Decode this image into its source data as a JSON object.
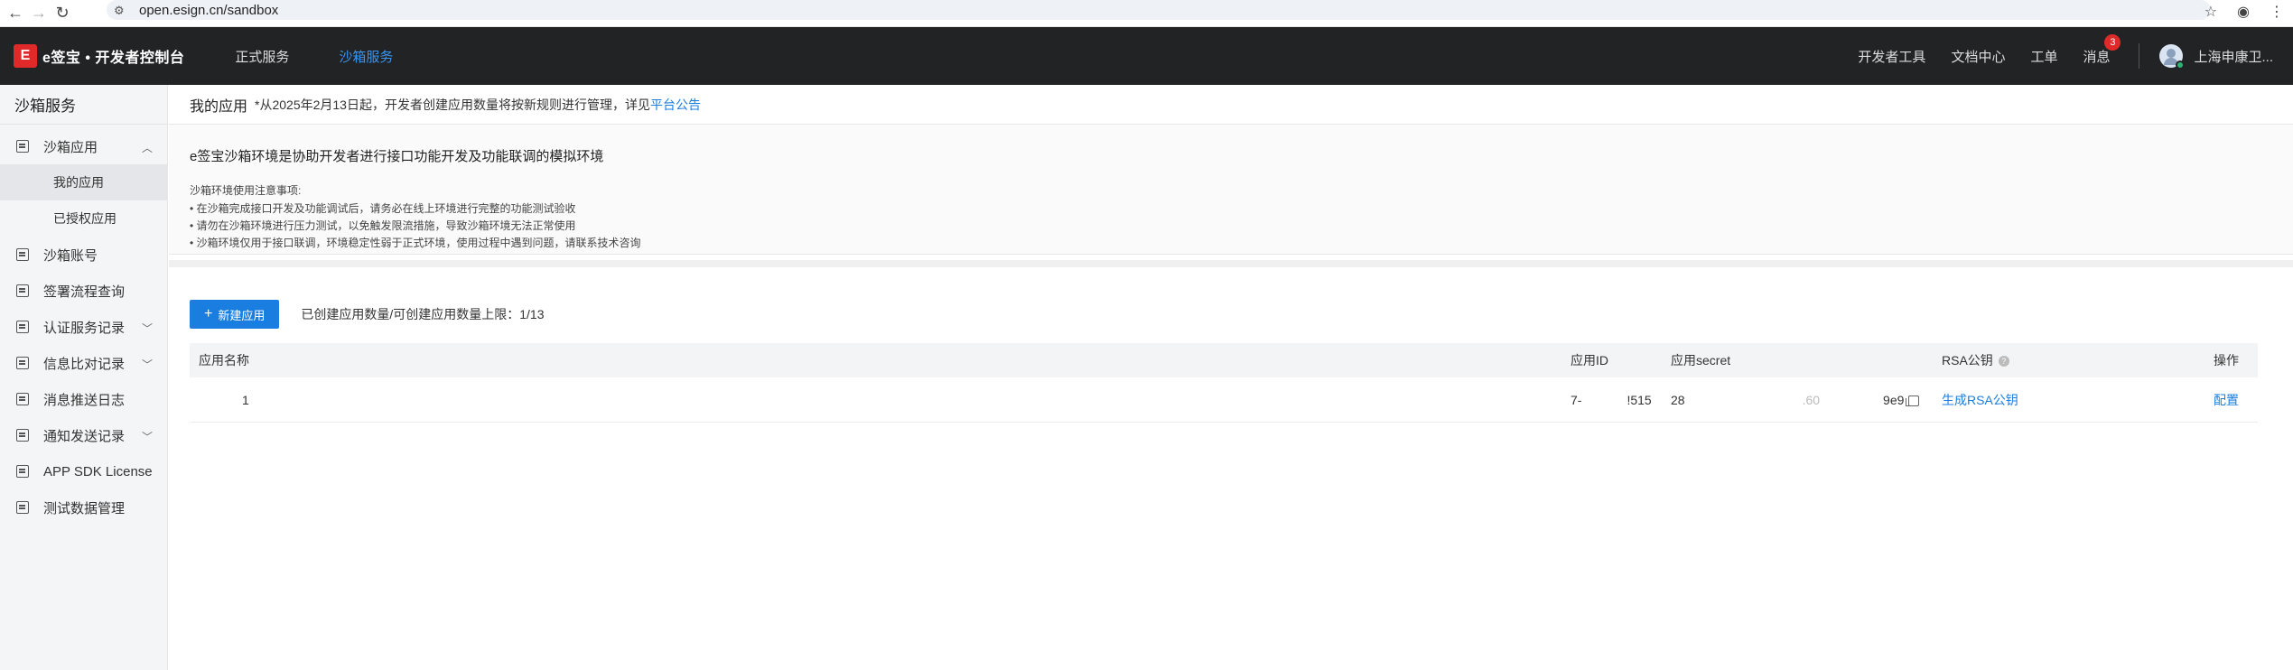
{
  "browser": {
    "url": "open.esign.cn/sandbox"
  },
  "topnav": {
    "logo_text": "e签宝 • 开发者控制台",
    "tabs": [
      {
        "label": "正式服务"
      },
      {
        "label": "沙箱服务"
      }
    ],
    "right_links": [
      "开发者工具",
      "文档中心",
      "工单",
      "消息"
    ],
    "message_count": "3",
    "company": "上海申康卫..."
  },
  "sidebar": {
    "title": "沙箱服务",
    "items": [
      {
        "label": "沙箱应用"
      },
      {
        "label": "我的应用"
      },
      {
        "label": "已授权应用"
      },
      {
        "label": "沙箱账号"
      },
      {
        "label": "签署流程查询"
      },
      {
        "label": "认证服务记录"
      },
      {
        "label": "信息比对记录"
      },
      {
        "label": "消息推送日志"
      },
      {
        "label": "通知发送记录"
      },
      {
        "label": "APP SDK License"
      },
      {
        "label": "测试数据管理"
      }
    ]
  },
  "main": {
    "title": "我的应用",
    "notice": "*从2025年2月13日起，开发者创建应用数量将按新规则进行管理，详见",
    "notice_link": "平台公告",
    "intro_title": "e签宝沙箱环境是协助开发者进行接口功能开发及功能联调的模拟环境",
    "intro_sub": "沙箱环境使用注意事项:",
    "intro_points": [
      "• 在沙箱完成接口开发及功能调试后，请务必在线上环境进行完整的功能测试验收",
      "• 请勿在沙箱环境进行压力测试，以免触发限流措施，导致沙箱环境无法正常使用",
      "• 沙箱环境仅用于接口联调，环境稳定性弱于正式环境，使用过程中遇到问题，请联系技术咨询"
    ],
    "new_app_button": "新建应用",
    "count_text": "已创建应用数量/可创建应用数量上限：1/13"
  },
  "table": {
    "headers": [
      "应用名称",
      "应用ID",
      "应用secret",
      "RSA公钥",
      "操作"
    ],
    "rows": [
      {
        "name": "1",
        "app_id_start": "7-",
        "app_id_end": "!515",
        "secret_start": "28",
        "secret_mid": ".60",
        "secret_end": "9e9",
        "rsa_action": "生成RSA公钥",
        "op": "配置"
      }
    ]
  }
}
